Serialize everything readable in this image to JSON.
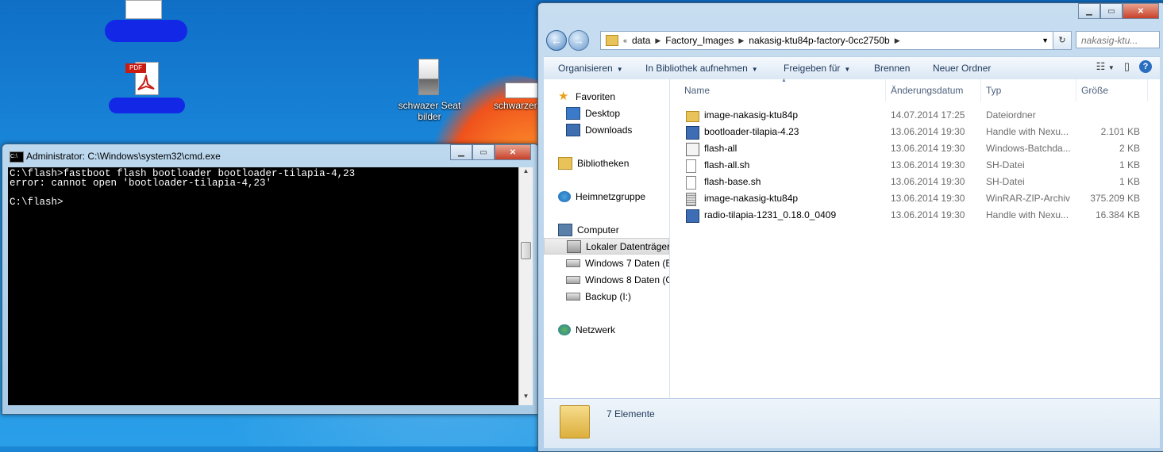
{
  "desktop": {
    "icons": [
      {
        "label": "schwazer Seat bilder",
        "icon": "image-file-icon"
      },
      {
        "label": "schwarzer",
        "icon": "document-file-icon"
      },
      {
        "label": "PDF",
        "icon": "pdf-file-icon"
      }
    ]
  },
  "cmd": {
    "title": "Administrator: C:\\Windows\\system32\\cmd.exe",
    "lines": [
      "C:\\flash>fastboot flash bootloader bootloader-tilapia-4,23",
      "error: cannot open 'bootloader-tilapia-4,23'",
      "",
      "C:\\flash>"
    ]
  },
  "explorer": {
    "breadcrumb": [
      "data",
      "Factory_Images",
      "nakasig-ktu84p-factory-0cc2750b"
    ],
    "breadcrumb_prefix": "«",
    "search_placeholder": "nakasig-ktu...",
    "toolbar": {
      "organise": "Organisieren",
      "library": "In Bibliothek aufnehmen",
      "share": "Freigeben für",
      "burn": "Brennen",
      "new_folder": "Neuer Ordner"
    },
    "nav": {
      "favorites": "Favoriten",
      "desktop": "Desktop",
      "downloads": "Downloads",
      "libraries": "Bibliotheken",
      "homegroup": "Heimnetzgruppe",
      "computer": "Computer",
      "local_disk": "Lokaler Datenträger",
      "win7": "Windows 7 Daten (E:",
      "win8": "Windows 8 Daten (G",
      "backup": "Backup (I:)",
      "network": "Netzwerk"
    },
    "columns": {
      "name": "Name",
      "date": "Änderungsdatum",
      "type": "Typ",
      "size": "Größe"
    },
    "files": [
      {
        "name": "image-nakasig-ktu84p",
        "date": "14.07.2014 17:25",
        "type": "Dateiordner",
        "size": ""
      },
      {
        "name": "bootloader-tilapia-4.23",
        "date": "13.06.2014 19:30",
        "type": "Handle with Nexu...",
        "size": "2.101 KB"
      },
      {
        "name": "flash-all",
        "date": "13.06.2014 19:30",
        "type": "Windows-Batchda...",
        "size": "2 KB"
      },
      {
        "name": "flash-all.sh",
        "date": "13.06.2014 19:30",
        "type": "SH-Datei",
        "size": "1 KB"
      },
      {
        "name": "flash-base.sh",
        "date": "13.06.2014 19:30",
        "type": "SH-Datei",
        "size": "1 KB"
      },
      {
        "name": "image-nakasig-ktu84p",
        "date": "13.06.2014 19:30",
        "type": "WinRAR-ZIP-Archiv",
        "size": "375.209 KB"
      },
      {
        "name": "radio-tilapia-1231_0.18.0_0409",
        "date": "13.06.2014 19:30",
        "type": "Handle with Nexu...",
        "size": "16.384 KB"
      }
    ],
    "status": "7 Elemente"
  }
}
